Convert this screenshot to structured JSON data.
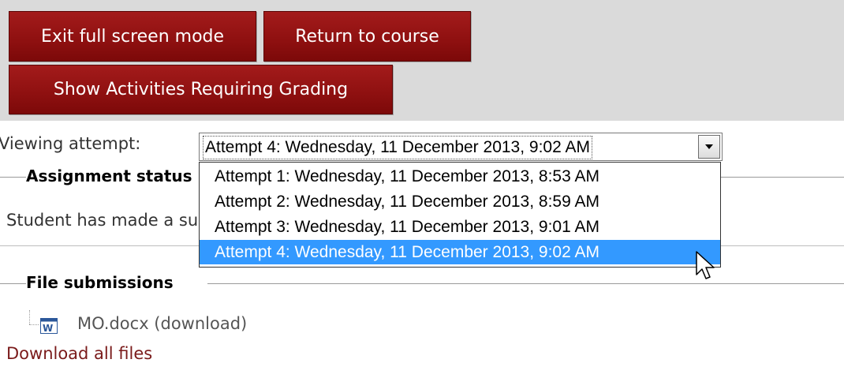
{
  "toolbar": {
    "exit_label": "Exit full screen mode",
    "return_label": "Return to course",
    "show_label": "Show Activities Requiring Grading"
  },
  "attempt_select": {
    "label": "Viewing attempt:",
    "selected_value": "Attempt 4: Wednesday, 11 December 2013, 9:02 AM",
    "options": [
      "Attempt 1: Wednesday, 11 December 2013, 8:53 AM",
      "Attempt 2: Wednesday, 11 December 2013, 8:59 AM",
      "Attempt 3: Wednesday, 11 December 2013, 9:01 AM",
      "Attempt 4: Wednesday, 11 December 2013, 9:02 AM"
    ],
    "highlighted_option": "Attempt 4: Wednesday, 11 December 2013, 9:02 AM"
  },
  "status_section": {
    "legend": "Assignment status",
    "text": "Student has made a submission for grading"
  },
  "files_section": {
    "legend": "File submissions",
    "file_name": "MO.docx (download)",
    "file_icon": "word-document-icon",
    "download_all": "Download all files"
  },
  "colors": {
    "button_bg": "#8e1010",
    "top_band": "#dadada",
    "highlight": "#3399ff",
    "link": "#7a1a1a"
  }
}
